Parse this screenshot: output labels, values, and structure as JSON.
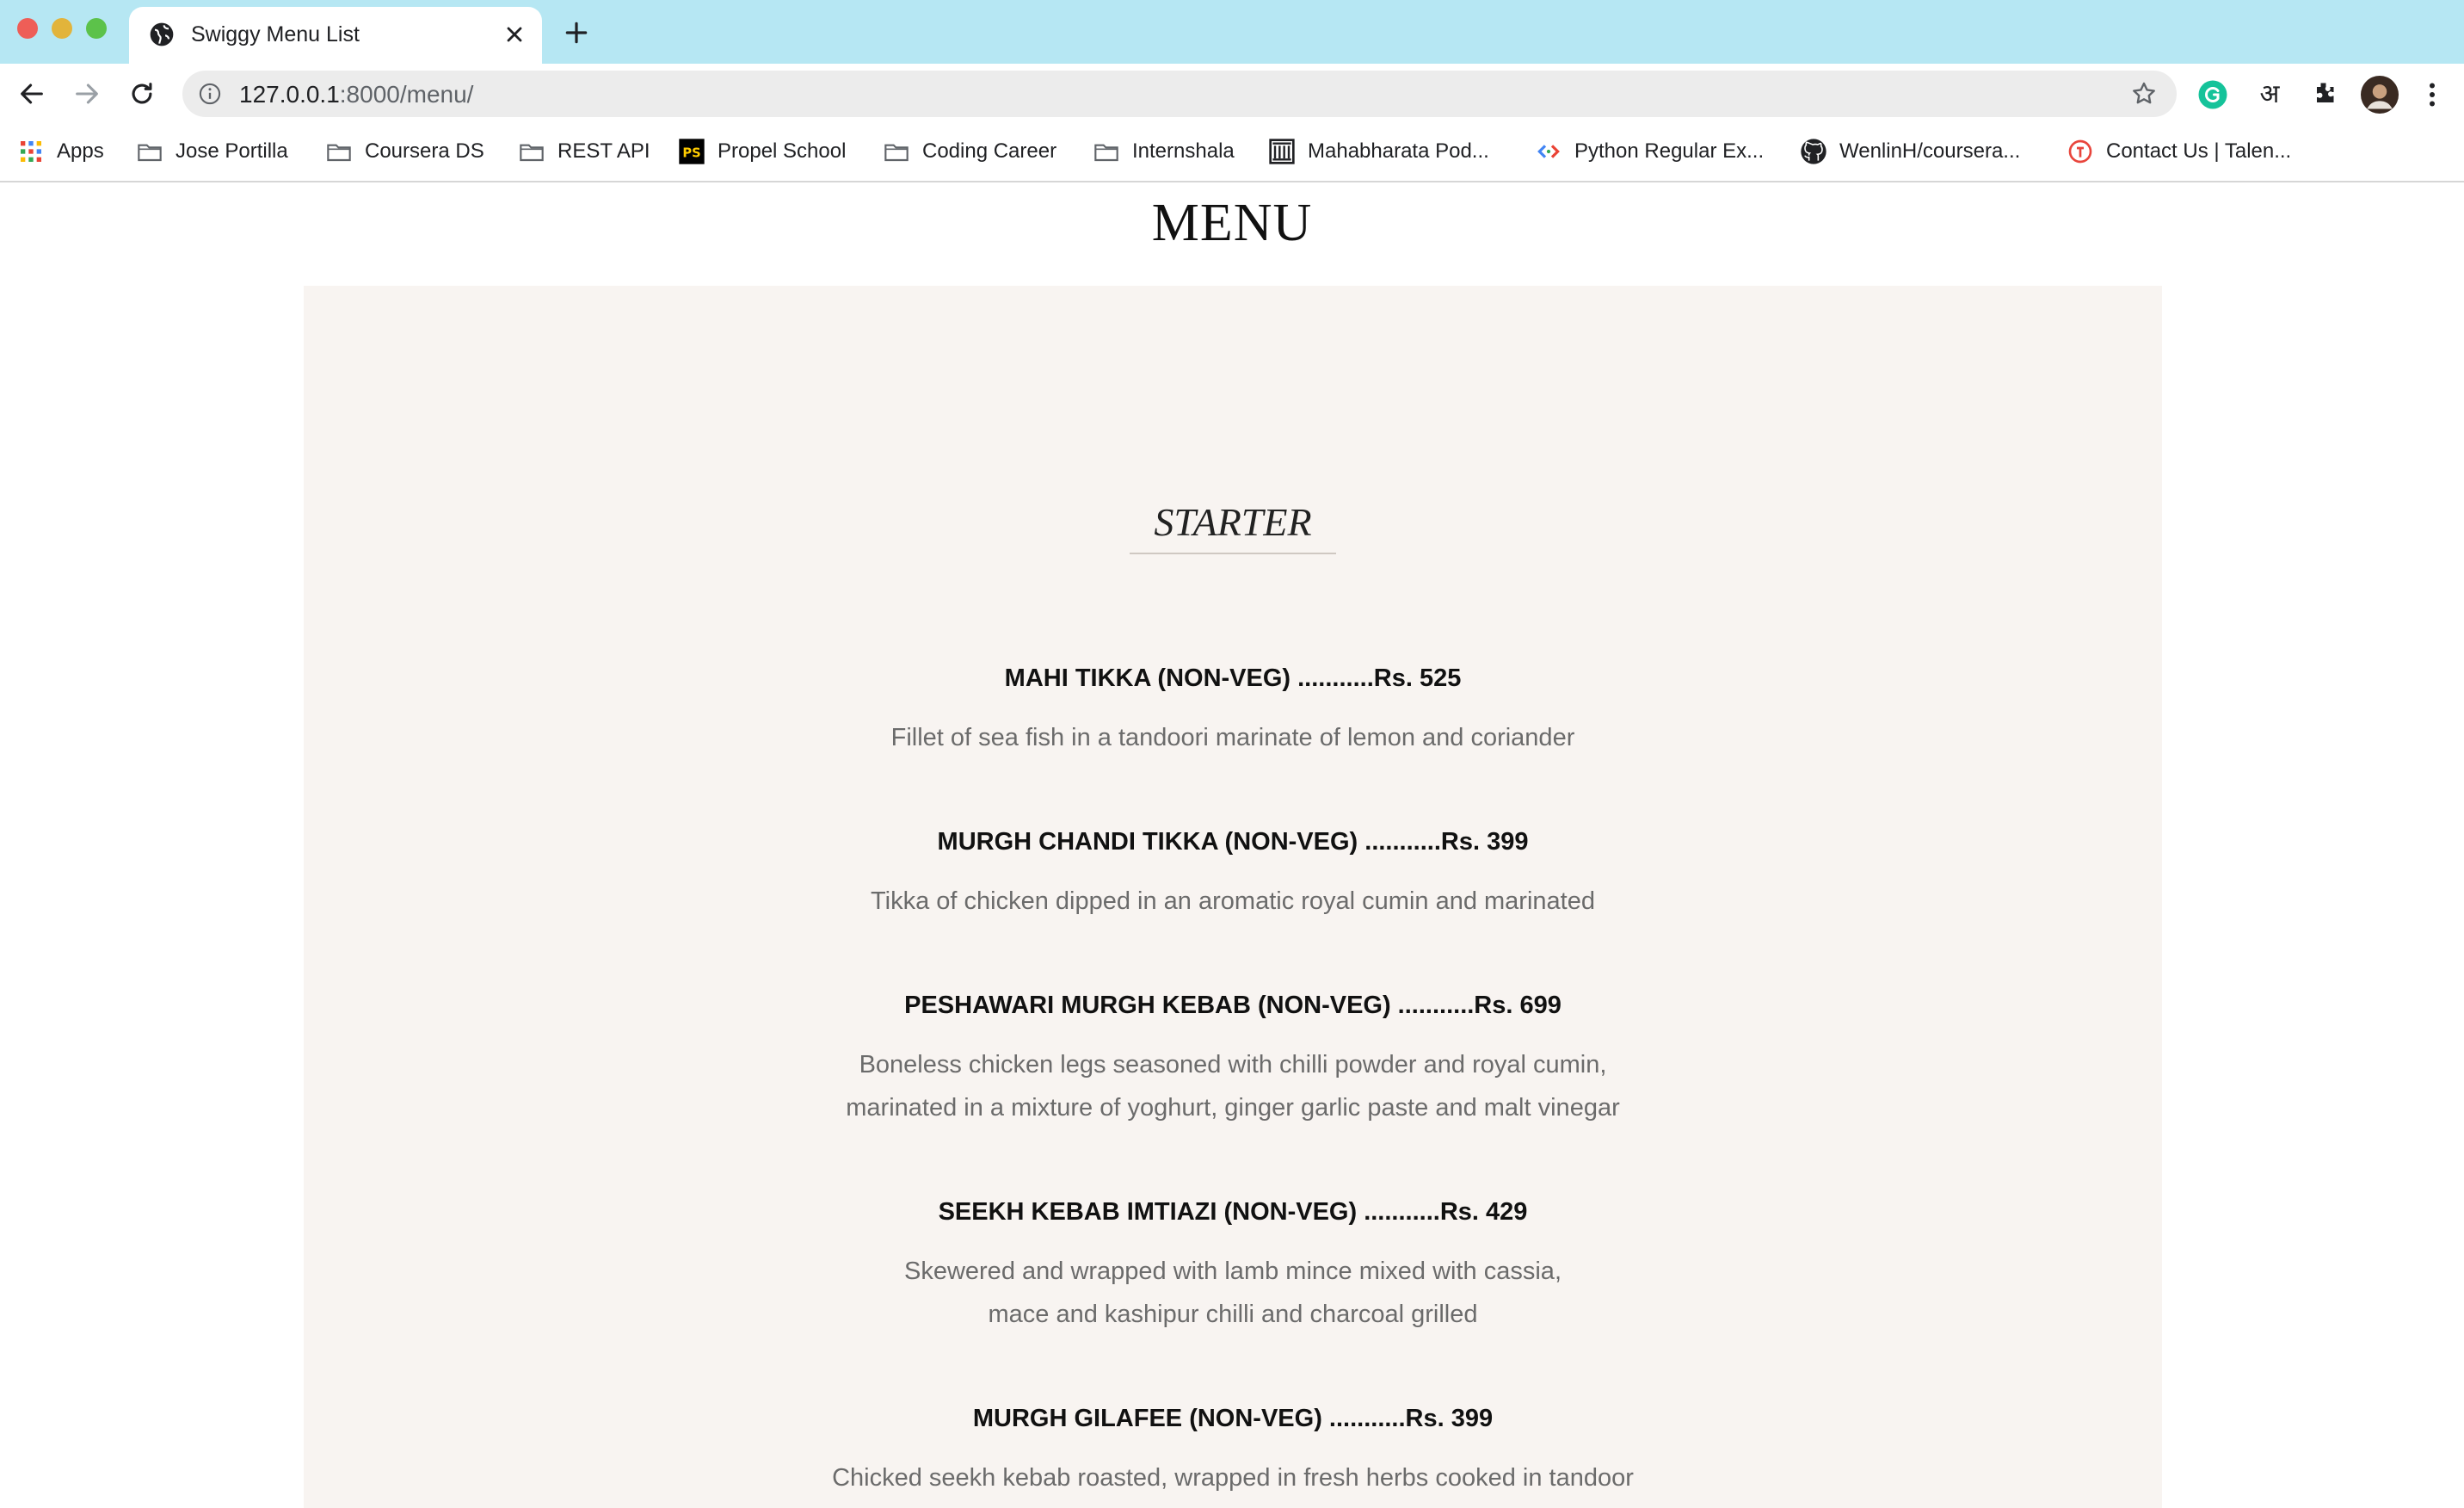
{
  "browser": {
    "tab_title": "Swiggy Menu List",
    "url_host": "127.0.0.1",
    "url_path": ":8000/menu/",
    "bookmarks": [
      {
        "label": "Apps",
        "icon": "apps-grid-icon"
      },
      {
        "label": "Jose Portilla",
        "icon": "folder-icon"
      },
      {
        "label": "Coursera DS",
        "icon": "folder-icon"
      },
      {
        "label": "REST API",
        "icon": "folder-icon"
      },
      {
        "label": "Propel School",
        "icon": "ps-icon"
      },
      {
        "label": "Coding Career",
        "icon": "folder-icon"
      },
      {
        "label": "Internshala",
        "icon": "folder-icon"
      },
      {
        "label": "Mahabharata Pod...",
        "icon": "building-icon"
      },
      {
        "label": "Python Regular Ex...",
        "icon": "code-icon"
      },
      {
        "label": "WenlinH/coursera...",
        "icon": "github-icon"
      },
      {
        "label": "Contact Us | Talen...",
        "icon": "talent-icon"
      }
    ],
    "hindi_ext_label": "अ"
  },
  "page": {
    "title": "MENU",
    "section": "STARTER",
    "items": [
      {
        "name": "MAHI TIKKA (NON-VEG) ...........Rs. 525",
        "desc": [
          "Fillet of sea fish in a tandoori marinate of lemon and coriander"
        ]
      },
      {
        "name": "MURGH CHANDI TIKKA (NON-VEG) ...........Rs. 399",
        "desc": [
          "Tikka of chicken dipped in an aromatic royal cumin and marinated"
        ]
      },
      {
        "name": "PESHAWARI MURGH KEBAB (NON-VEG) ...........Rs. 699",
        "desc": [
          "Boneless chicken legs seasoned with chilli powder and royal cumin,",
          "marinated in a mixture of yoghurt, ginger garlic paste and malt vinegar"
        ]
      },
      {
        "name": "SEEKH KEBAB IMTIAZI (NON-VEG) ...........Rs. 429",
        "desc": [
          "Skewered and wrapped with lamb mince mixed with cassia,",
          "mace and kashipur chilli and charcoal grilled"
        ]
      },
      {
        "name": "MURGH GILAFEE (NON-VEG) ...........Rs. 399",
        "desc": [
          "Chicked seekh kebab roasted, wrapped in fresh herbs cooked in tandoor"
        ]
      }
    ]
  },
  "colors": {
    "tabbar": "#b6e7f3",
    "panel": "#f8f4f1",
    "desc_text": "#6b6b6b"
  }
}
